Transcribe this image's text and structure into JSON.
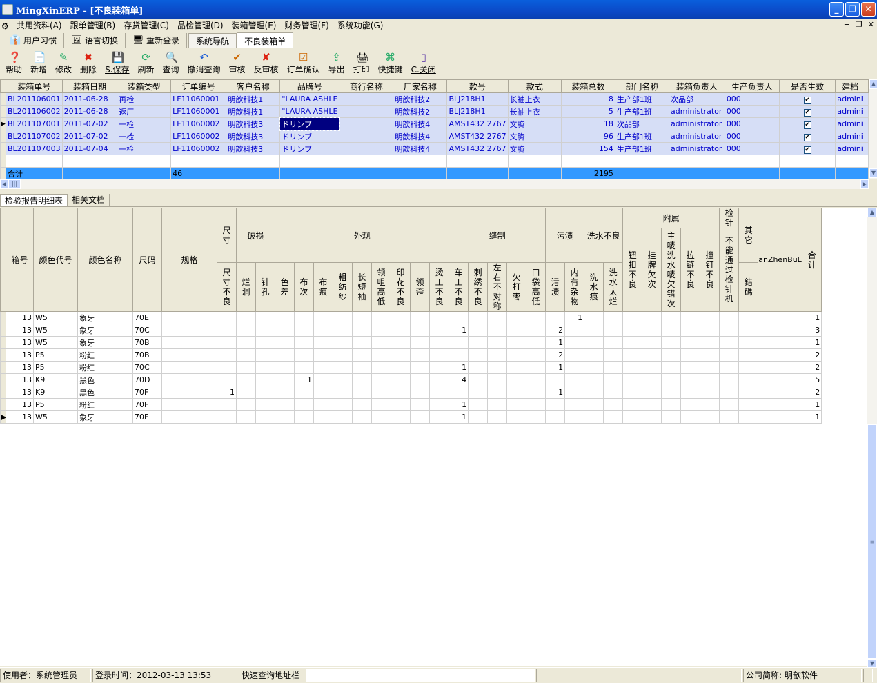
{
  "window": {
    "title": "MingXinERP - [不良装箱单]",
    "min": "_",
    "restore": "❐",
    "close": "✕"
  },
  "menu": [
    {
      "label": "共用资料(A)"
    },
    {
      "label": "跟单管理(B)"
    },
    {
      "label": "存货管理(C)"
    },
    {
      "label": "品检管理(D)"
    },
    {
      "label": "装箱管理(E)"
    },
    {
      "label": "财务管理(F)"
    },
    {
      "label": "系统功能(G)"
    }
  ],
  "tabs": [
    {
      "label": "用户习惯",
      "icon": "👔"
    },
    {
      "label": "语言切换",
      "icon": "🖼"
    },
    {
      "label": "重新登录",
      "icon": "🖥"
    },
    {
      "label": "系统导航"
    },
    {
      "label": "不良装箱单"
    }
  ],
  "toolbar": [
    {
      "label": "帮助",
      "icon": "❓"
    },
    {
      "label": "新增",
      "icon": "📄"
    },
    {
      "label": "修改",
      "icon": "✎"
    },
    {
      "label": "删除",
      "icon": "✖"
    },
    {
      "label": "S.保存",
      "icon": "💾"
    },
    {
      "label": "刷新",
      "icon": "⟳"
    },
    {
      "label": "查询",
      "icon": "🔍"
    },
    {
      "label": "撤消查询",
      "icon": "↶"
    },
    {
      "label": "审核",
      "icon": "✔"
    },
    {
      "label": "反审核",
      "icon": "✘"
    },
    {
      "label": "订单确认",
      "icon": "☑"
    },
    {
      "label": "导出",
      "icon": "⇪"
    },
    {
      "label": "打印",
      "icon": "🖨"
    },
    {
      "label": "快捷键",
      "icon": "⌘"
    },
    {
      "label": "C.关闭",
      "icon": "▯"
    }
  ],
  "master": {
    "columns": [
      "装箱单号",
      "装箱日期",
      "装箱类型",
      "订单编号",
      "客户名称",
      "品牌号",
      "商行名称",
      "厂家名称",
      "款号",
      "款式",
      "装箱总数",
      "部门名称",
      "装箱负责人",
      "生产负责人",
      "是否生效",
      "建档"
    ],
    "rows": [
      {
        "c": [
          "BL201106001",
          "2011-06-28",
          "再检",
          "LF11060001",
          "明歆科技1",
          "\"LAURA ASHLE",
          "",
          "明歆科技2",
          "BLJ218H1",
          "长袖上衣",
          "8",
          "生产部1班",
          "次品部",
          "000",
          "✔",
          "admini"
        ]
      },
      {
        "c": [
          "BL201106002",
          "2011-06-28",
          "返厂",
          "LF11060001",
          "明歆科技1",
          "\"LAURA ASHLE",
          "",
          "明歆科技2",
          "BLJ218H1",
          "长袖上衣",
          "5",
          "生产部1班",
          "administrator",
          "000",
          "✔",
          "admini"
        ]
      },
      {
        "c": [
          "BL201107001",
          "2011-07-02",
          "一检",
          "LF11060002",
          "明歆科技3",
          "ドリンブ",
          "",
          "明歆科技4",
          "AMST432 2767",
          "文胸",
          "18",
          "次品部",
          "administrator",
          "000",
          "✔",
          "admini"
        ]
      },
      {
        "c": [
          "BL201107002",
          "2011-07-02",
          "一检",
          "LF11060002",
          "明歆科技3",
          "ドリンブ",
          "",
          "明歆科技4",
          "AMST432 2767",
          "文胸",
          "96",
          "生产部1班",
          "administrator",
          "000",
          "✔",
          "admini"
        ]
      },
      {
        "c": [
          "BL201107003",
          "2011-07-04",
          "一检",
          "LF11060002",
          "明歆科技3",
          "ドリンブ",
          "",
          "明歆科技4",
          "AMST432 2767",
          "文胸",
          "154",
          "生产部1班",
          "administrator",
          "000",
          "✔",
          "admini"
        ]
      }
    ],
    "total": {
      "label": "合计",
      "order_count": "46",
      "box_total": "2195"
    }
  },
  "subtabs": [
    "检验报告明细表",
    "相关文档"
  ],
  "detail": {
    "h": {
      "box": "箱号",
      "color_code": "颜色代号",
      "color_name": "颜色名称",
      "size": "尺码",
      "spec": "规格",
      "chicun": "尺寸",
      "chicun_bl": "尺寸不良",
      "posun": "破损",
      "lan": "烂洞",
      "zhen": "针孔",
      "waiguan": "外观",
      "sec": "色差",
      "buci": "布次",
      "buhen": "布痕",
      "cusha": "粗纺纱",
      "changduan": "长短袖",
      "lingju": "领咀高低",
      "yinhua": "印花不良",
      "lingwai": "领歪",
      "tang": "烫工不良",
      "fengzhi": "缝制",
      "chegong": "车工不良",
      "cixiu": "刺绣不良",
      "zuoyou": "左右不对称",
      "qianda": "欠打枣",
      "koudai": "口袋高低",
      "wuzi": "污渍",
      "wuzi2": "污渍",
      "neiyou": "内有杂物",
      "xishui": "洗水不良",
      "xishuihen": "洗水痕",
      "xishuitai": "洗水太烂",
      "fushu": "附属",
      "niukou": "钮扣不良",
      "guapai": "挂牌欠次",
      "zhumai": "主唛洗水唛欠错次",
      "lalian": "拉链不良",
      "zhuangding": "撞钉不良",
      "jianzhen": "检针",
      "buneng": "不能通过检针机",
      "qita": "其它",
      "cuoma": "錯碼",
      "ban": "anZhenBuLia",
      "heji": "合计"
    },
    "rows": [
      {
        "box": "13",
        "cc": "W5",
        "cn": "象牙",
        "size": "70E",
        "neiyou": "1",
        "total": "1"
      },
      {
        "box": "13",
        "cc": "W5",
        "cn": "象牙",
        "size": "70C",
        "chegong": "1",
        "wuzi": "2",
        "total": "3"
      },
      {
        "box": "13",
        "cc": "W5",
        "cn": "象牙",
        "size": "70B",
        "wuzi": "1",
        "total": "1"
      },
      {
        "box": "13",
        "cc": "P5",
        "cn": "粉红",
        "size": "70B",
        "wuzi": "2",
        "total": "2"
      },
      {
        "box": "13",
        "cc": "P5",
        "cn": "粉红",
        "size": "70C",
        "chegong": "1",
        "wuzi": "1",
        "total": "2"
      },
      {
        "box": "13",
        "cc": "K9",
        "cn": "黑色",
        "size": "70D",
        "buci": "1",
        "chegong": "4",
        "total": "5"
      },
      {
        "box": "13",
        "cc": "K9",
        "cn": "黑色",
        "size": "70F",
        "chicun": "1",
        "wuzi": "1",
        "total": "2"
      },
      {
        "box": "13",
        "cc": "P5",
        "cn": "粉红",
        "size": "70F",
        "chegong": "1",
        "total": "1"
      },
      {
        "box": "13",
        "cc": "W5",
        "cn": "象牙",
        "size": "70F",
        "chegong": "1",
        "total": "1"
      }
    ]
  },
  "status": {
    "user": "使用者：系统管理员",
    "login": "登录时间：2012-03-13 13:53",
    "quick": "快速查询地址栏",
    "company": "公司简称: 明歆软件"
  }
}
